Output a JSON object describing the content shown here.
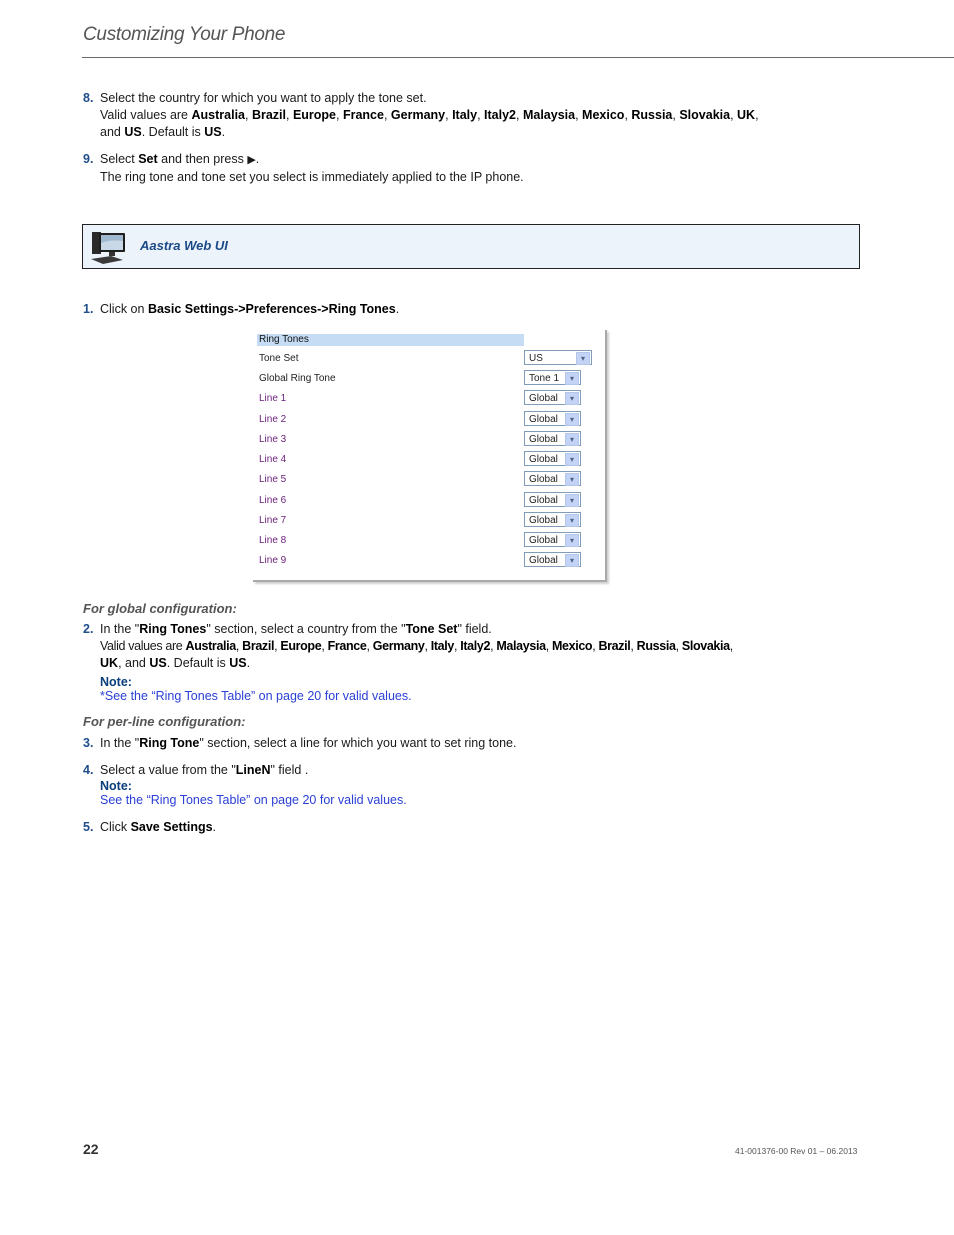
{
  "header": {
    "title": "Customizing Your Phone"
  },
  "steps_top": [
    {
      "num": "8.",
      "line1": "Select the country for which you want to apply the tone set.",
      "line2_prefix": "Valid values are ",
      "countries": [
        "Australia",
        "Brazil",
        "Europe",
        "France",
        "Germany",
        "Italy",
        "Italy2",
        "Malaysia",
        "Mexico",
        "Russia",
        "Slovakia",
        "UK"
      ],
      "line3_and": "and ",
      "last_country": "US",
      "default_text": ". Default is ",
      "default_value": "US",
      "end": "."
    },
    {
      "num": "9.",
      "line1_prefix": "Select ",
      "line1_bold": "Set",
      "line1_mid": " and then press ",
      "arrow_icon": "▶",
      "line1_end": ".",
      "line2": "The ring tone and tone set you select is immediately applied to the IP phone."
    }
  ],
  "webui": {
    "label": "Aastra Web UI",
    "icon": "desktop-computer-icon"
  },
  "step1": {
    "num": "1.",
    "prefix": "Click on ",
    "path": "Basic Settings->Preferences->Ring Tones",
    "end": "."
  },
  "screenshot": {
    "section_title": "Ring Tones",
    "rows": [
      {
        "label": "Tone Set",
        "value": "US"
      },
      {
        "label": "Global Ring Tone",
        "value": "Tone 1"
      },
      {
        "label": "Line 1",
        "value": "Global"
      },
      {
        "label": "Line 2",
        "value": "Global"
      },
      {
        "label": "Line 3",
        "value": "Global"
      },
      {
        "label": "Line 4",
        "value": "Global"
      },
      {
        "label": "Line 5",
        "value": "Global"
      },
      {
        "label": "Line 6",
        "value": "Global"
      },
      {
        "label": "Line 7",
        "value": "Global"
      },
      {
        "label": "Line 8",
        "value": "Global"
      },
      {
        "label": "Line 9",
        "value": "Global"
      }
    ],
    "dropdown_arrow": "▾"
  },
  "global_config": {
    "heading": "For global configuration:",
    "num": "2.",
    "l1_a": "In the \"",
    "l1_b": "Ring Tones",
    "l1_c": "\" section, select a country from the \"",
    "l1_d": "Tone Set",
    "l1_e": "\" field.",
    "l2_prefix": "Valid values are ",
    "countries": [
      "Australia",
      "Brazil",
      "Europe",
      "France",
      "Germany",
      "Italy",
      "Italy2",
      "Malaysia",
      "Mexico",
      "Brazil",
      "Russia",
      "Slovakia"
    ],
    "l3_first": "UK",
    "l3_and": ", and ",
    "l3_last": "US",
    "l3_default": ". Default is ",
    "l3_default_value": "US",
    "l3_end": ".",
    "note_label": "Note:",
    "note_prefix": "*See the ",
    "note_link": "“Ring Tones Table” on page 20",
    "note_suffix": " for valid values."
  },
  "perline_config": {
    "heading": "For per-line configuration:",
    "step3": {
      "num": "3.",
      "a": "In the \"",
      "b": "Ring Tone",
      "c": "\" section, select a line for which you want to set ring tone."
    },
    "step4": {
      "num": "4.",
      "a": "Select a value from the \"",
      "b": "LineN",
      "c": "\" field .",
      "note_label": "Note:",
      "note_prefix": "See the ",
      "note_link": "“Ring Tones Table” on page 20",
      "note_suffix": " for valid values."
    },
    "step5": {
      "num": "5.",
      "a": "Click ",
      "b": "Save Settings",
      "c": "."
    }
  },
  "footer": {
    "page_number": "22",
    "doc_id": "41-001376-00 Rev 01 – 06.2013"
  }
}
